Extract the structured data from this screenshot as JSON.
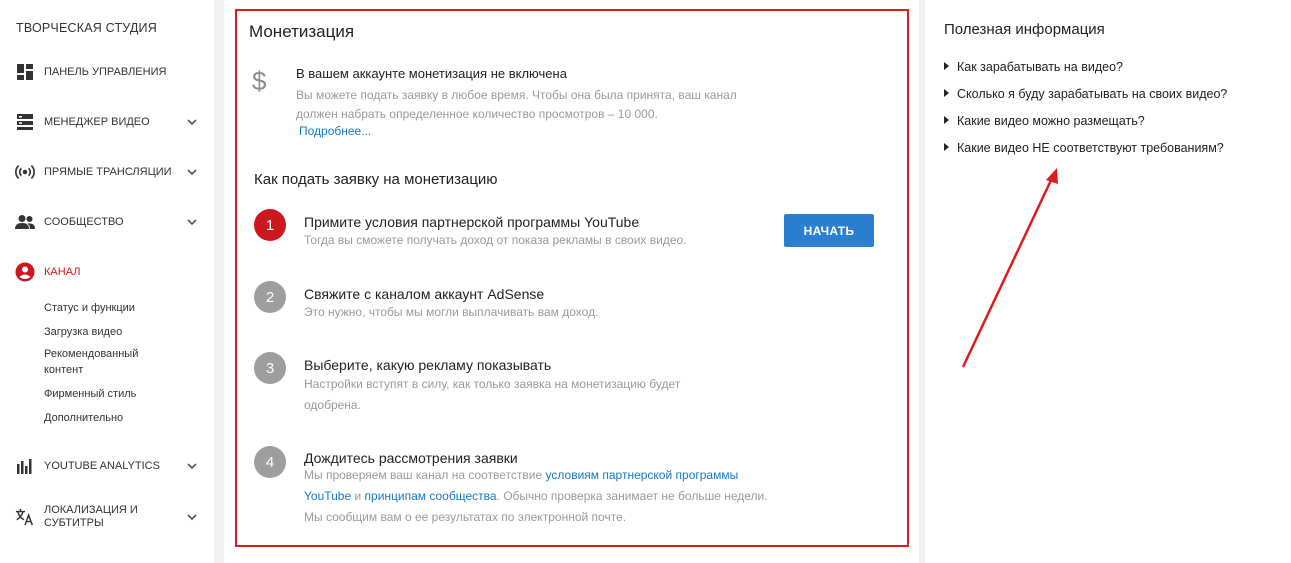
{
  "sidebar": {
    "title": "ТВОРЧЕСКАЯ СТУДИЯ",
    "items": [
      {
        "label": "ПАНЕЛЬ УПРАВЛЕНИЯ",
        "icon": "dashboard-icon"
      },
      {
        "label": "МЕНЕДЖЕР ВИДЕО",
        "icon": "video-manager-icon"
      },
      {
        "label": "ПРЯМЫЕ ТРАНСЛЯЦИИ",
        "icon": "live-stream-icon"
      },
      {
        "label": "СООБЩЕСТВО",
        "icon": "community-icon"
      },
      {
        "label": "КАНАЛ",
        "icon": "channel-icon"
      },
      {
        "label": "YOUTUBE ANALYTICS",
        "icon": "analytics-icon"
      },
      {
        "label": "ЛОКАЛИЗАЦИЯ И СУБТИТРЫ",
        "icon": "translate-icon"
      }
    ],
    "channel_sub": [
      "Статус и функции",
      "Загрузка видео",
      "Рекомендованный контент",
      "Фирменный стиль",
      "Дополнительно"
    ],
    "accent_color": "#cc181e"
  },
  "main": {
    "title": "Монетизация",
    "notice_title": "В вашем аккаунте монетизация не включена",
    "notice_text": "Вы можете подать заявку в любое время. Чтобы она была принята, ваш канал должен набрать определенное количество просмотров – 10 000.",
    "more_link": "Подробнее...",
    "how_title": "Как подать заявку на монетизацию",
    "start_button": "НАЧАТЬ",
    "steps": [
      {
        "num": "1",
        "title": "Примите условия партнерской программы YouTube",
        "desc": "Тогда вы сможете получать доход от показа рекламы в своих видео."
      },
      {
        "num": "2",
        "title": "Свяжите с каналом аккаунт AdSense",
        "desc": "Это нужно, чтобы мы могли выплачивать вам доход."
      },
      {
        "num": "3",
        "title": "Выберите, какую рекламу показывать",
        "desc": "Настройки вступят в силу, как только заявка на монетизацию будет одобрена."
      },
      {
        "num": "4",
        "title": "Дождитесь рассмотрения заявки",
        "desc_a": "Мы проверяем ваш канал на соответствие ",
        "desc_link1": "условиям партнерской программы YouTube",
        "desc_b": " и ",
        "desc_link2": "принципам сообщества",
        "desc_c": ". Обычно проверка занимает не больше недели. Мы сообщим вам о ее результатах по электронной почте."
      }
    ],
    "link_color": "#167ac6",
    "highlight_color": "#e01b1b"
  },
  "info": {
    "title": "Полезная информация",
    "items": [
      "Как зарабатывать на видео?",
      "Сколько я буду зарабатывать на своих видео?",
      "Какие видео можно размещать?",
      "Какие видео НЕ соответствуют требованиям?"
    ]
  }
}
